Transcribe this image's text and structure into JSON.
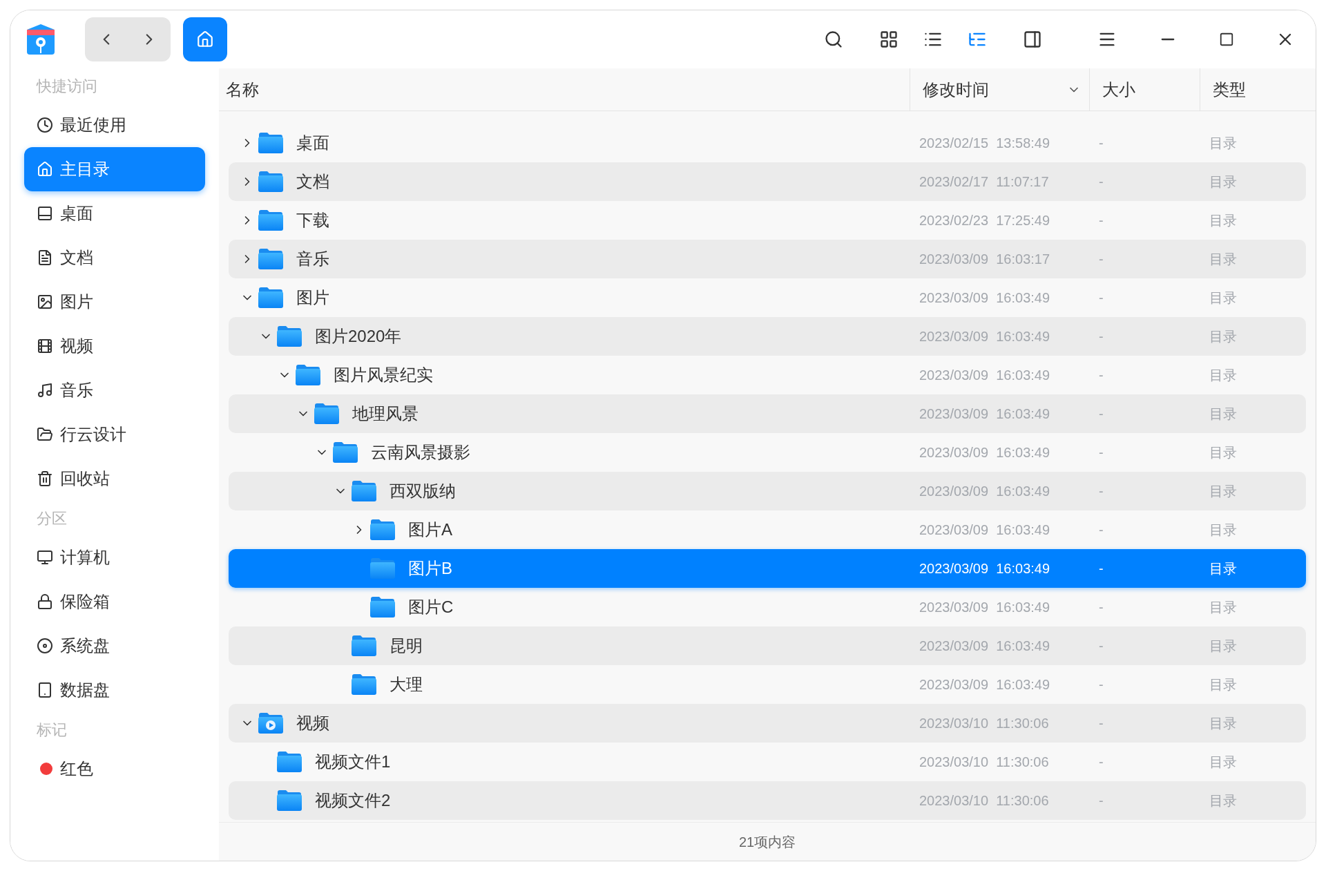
{
  "toolbar": {
    "view_modes": [
      {
        "selected": false
      },
      {
        "selected": false
      },
      {
        "selected": true
      }
    ]
  },
  "sidebar": {
    "sections": [
      {
        "title": "快捷访问",
        "items": [
          {
            "kind": "place",
            "label": "最近使用",
            "selected": false
          },
          {
            "kind": "place",
            "label": "主目录",
            "selected": true
          },
          {
            "kind": "place",
            "label": "桌面",
            "selected": false
          },
          {
            "kind": "place",
            "label": "文档",
            "selected": false
          },
          {
            "kind": "place",
            "label": "图片",
            "selected": false
          },
          {
            "kind": "place",
            "label": "视频",
            "selected": false
          },
          {
            "kind": "place",
            "label": "音乐",
            "selected": false
          },
          {
            "kind": "place",
            "label": "行云设计",
            "selected": false
          },
          {
            "kind": "place",
            "label": "回收站",
            "selected": false
          }
        ]
      },
      {
        "title": "分区",
        "items": [
          {
            "kind": "place",
            "label": "计算机",
            "selected": false
          },
          {
            "kind": "place",
            "label": "保险箱",
            "selected": false
          },
          {
            "kind": "place",
            "label": "系统盘",
            "selected": false
          },
          {
            "kind": "place",
            "label": "数据盘",
            "selected": false
          }
        ]
      },
      {
        "title": "标记",
        "items": [
          {
            "kind": "tag",
            "label": "红色",
            "color": "#f23c3c",
            "selected": false
          }
        ]
      }
    ]
  },
  "table": {
    "columns": [
      {
        "label": "名称"
      },
      {
        "label": "修改时间",
        "sorted": true
      },
      {
        "label": "大小"
      },
      {
        "label": "类型"
      }
    ],
    "rows": [
      {
        "kind": "folder",
        "name": "桌面",
        "modified": "2023/02/15  13:58:49",
        "size": "-",
        "type": "目录",
        "expanded": false,
        "selected": false
      },
      {
        "kind": "folder",
        "name": "文档",
        "modified": "2023/02/17  11:07:17",
        "size": "-",
        "type": "目录",
        "expanded": false,
        "selected": false
      },
      {
        "kind": "folder",
        "name": "下载",
        "modified": "2023/02/23  17:25:49",
        "size": "-",
        "type": "目录",
        "expanded": false,
        "selected": false
      },
      {
        "kind": "folder",
        "name": "音乐",
        "modified": "2023/03/09  16:03:17",
        "size": "-",
        "type": "目录",
        "expanded": false,
        "selected": false
      },
      {
        "kind": "folder",
        "name": "图片",
        "modified": "2023/03/09  16:03:49",
        "size": "-",
        "type": "目录",
        "expanded": true,
        "selected": false,
        "children": [
          {
            "kind": "folder",
            "name": "图片2020年",
            "modified": "2023/03/09  16:03:49",
            "size": "-",
            "type": "目录",
            "expanded": true,
            "selected": false,
            "children": [
              {
                "kind": "folder",
                "name": "图片风景纪实",
                "modified": "2023/03/09  16:03:49",
                "size": "-",
                "type": "目录",
                "expanded": true,
                "selected": false,
                "children": [
                  {
                    "kind": "folder",
                    "name": "地理风景",
                    "modified": "2023/03/09  16:03:49",
                    "size": "-",
                    "type": "目录",
                    "expanded": true,
                    "selected": false,
                    "children": [
                      {
                        "kind": "folder",
                        "name": "云南风景摄影",
                        "modified": "2023/03/09  16:03:49",
                        "size": "-",
                        "type": "目录",
                        "expanded": true,
                        "selected": false,
                        "children": [
                          {
                            "kind": "folder",
                            "name": "西双版纳",
                            "modified": "2023/03/09  16:03:49",
                            "size": "-",
                            "type": "目录",
                            "expanded": true,
                            "selected": false,
                            "children": [
                              {
                                "kind": "folder",
                                "name": "图片A",
                                "modified": "2023/03/09  16:03:49",
                                "size": "-",
                                "type": "目录",
                                "expanded": false,
                                "selected": false
                              },
                              {
                                "kind": "folder",
                                "name": "图片B",
                                "modified": "2023/03/09  16:03:49",
                                "size": "-",
                                "type": "目录",
                                "selected": true
                              },
                              {
                                "kind": "folder",
                                "name": "图片C",
                                "modified": "2023/03/09  16:03:49",
                                "size": "-",
                                "type": "目录",
                                "selected": false
                              }
                            ]
                          },
                          {
                            "kind": "folder",
                            "name": "昆明",
                            "modified": "2023/03/09  16:03:49",
                            "size": "-",
                            "type": "目录",
                            "selected": false
                          },
                          {
                            "kind": "folder",
                            "name": "大理",
                            "modified": "2023/03/09  16:03:49",
                            "size": "-",
                            "type": "目录",
                            "selected": false
                          }
                        ]
                      }
                    ]
                  }
                ]
              }
            ]
          }
        ]
      },
      {
        "kind": "video-folder",
        "name": "视频",
        "modified": "2023/03/10  11:30:06",
        "size": "-",
        "type": "目录",
        "expanded": true,
        "selected": false,
        "children": [
          {
            "kind": "folder",
            "name": "视频文件1",
            "modified": "2023/03/10  11:30:06",
            "size": "-",
            "type": "目录",
            "selected": false
          },
          {
            "kind": "folder",
            "name": "视频文件2",
            "modified": "2023/03/10  11:30:06",
            "size": "-",
            "type": "目录",
            "selected": false
          }
        ]
      }
    ]
  },
  "status_bar": {
    "text": "21项内容"
  }
}
